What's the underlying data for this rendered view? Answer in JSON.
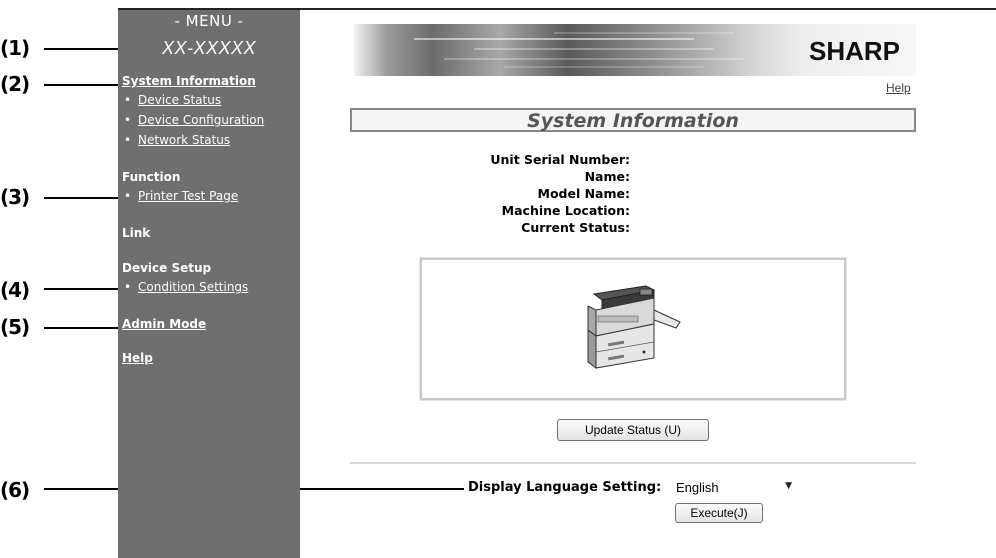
{
  "callouts": [
    "(1)",
    "(2)",
    "(3)",
    "(4)",
    "(5)",
    "(6)"
  ],
  "sidebar": {
    "menu_title": "- MENU -",
    "model_name": "XX-XXXXX",
    "system_information": "System Information",
    "system_items": [
      "Device Status",
      "Device Configuration",
      "Network Status"
    ],
    "function_heading": "Function",
    "function_items": [
      "Printer Test Page"
    ],
    "link_heading": "Link",
    "device_setup_heading": "Device Setup",
    "device_setup_items": [
      "Condition Settings"
    ],
    "admin_mode": "Admin Mode",
    "help": "Help",
    "bullet": "•",
    "background_color": "#6f6f6f"
  },
  "banner": {
    "logo": "SHARP"
  },
  "main": {
    "help_link": "Help",
    "section_title": "System Information",
    "info_labels": [
      "Unit Serial Number:",
      "Name:",
      "Model Name:",
      "Machine Location:",
      "Current Status:"
    ],
    "device_image": "copier-illustration-icon",
    "update_button": "Update Status (U)",
    "language_label": "Display Language Setting:",
    "language_selected": "English",
    "execute_button": "Execute(J)"
  }
}
